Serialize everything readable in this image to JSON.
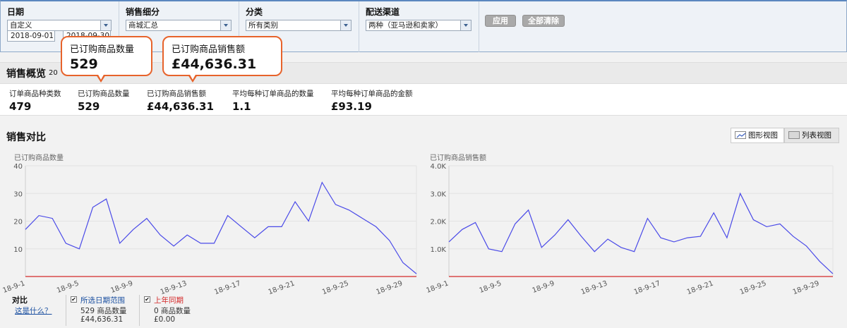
{
  "filters": {
    "date": {
      "label": "日期",
      "value": "自定义",
      "from": "2018-09-01",
      "to": "2018-09-30"
    },
    "sales_breakdown": {
      "label": "销售细分",
      "value": "商城汇总"
    },
    "category": {
      "label": "分类",
      "value": "所有类别"
    },
    "fulfillment": {
      "label": "配送渠道",
      "value": "两种（亚马逊和卖家）"
    },
    "apply_label": "应用",
    "clear_label": "全部清除"
  },
  "callouts": [
    {
      "label": "已订购商品数量",
      "value": "529"
    },
    {
      "label": "已订购商品销售额",
      "value": "£44,636.31"
    }
  ],
  "overview": {
    "title": "销售概览",
    "date_prefix": "20",
    "metrics": [
      {
        "label": "订单商品种类数",
        "value": "479"
      },
      {
        "label": "已订购商品数量",
        "value": "529"
      },
      {
        "label": "已订购商品销售额",
        "value": "£44,636.31"
      },
      {
        "label": "平均每种订单商品的数量",
        "value": "1.1"
      },
      {
        "label": "平均每种订单商品的金额",
        "value": "£93.19"
      }
    ]
  },
  "comparison": {
    "title": "销售对比",
    "graph_view_label": "图形视图",
    "table_view_label": "列表视图"
  },
  "chart_data": [
    {
      "type": "line",
      "title": "已订购商品数量",
      "x": [
        "18-9-1",
        "18-9-2",
        "18-9-3",
        "18-9-4",
        "18-9-5",
        "18-9-6",
        "18-9-7",
        "18-9-8",
        "18-9-9",
        "18-9-10",
        "18-9-11",
        "18-9-12",
        "18-9-13",
        "18-9-14",
        "18-9-15",
        "18-9-16",
        "18-9-17",
        "18-9-18",
        "18-9-19",
        "18-9-20",
        "18-9-21",
        "18-9-22",
        "18-9-23",
        "18-9-24",
        "18-9-25",
        "18-9-26",
        "18-9-27",
        "18-9-28",
        "18-9-29",
        "18-9-30"
      ],
      "x_tick_labels": [
        "18-9-1",
        "18-9-5",
        "18-9-9",
        "18-9-13",
        "18-9-17",
        "18-9-21",
        "18-9-25",
        "18-9-29"
      ],
      "y_ticks": [
        "10",
        "20",
        "30",
        "40"
      ],
      "ylim": [
        0,
        40
      ],
      "series": [
        {
          "name": "所选日期范围",
          "color": "#4a4ae8",
          "values": [
            17,
            22,
            21,
            12,
            10,
            25,
            28,
            12,
            17,
            21,
            15,
            11,
            15,
            12,
            12,
            22,
            18,
            14,
            18,
            18,
            27,
            20,
            34,
            26,
            24,
            21,
            18,
            13,
            5,
            1
          ]
        },
        {
          "name": "上年同期",
          "color": "#d42a2a",
          "values": [
            0,
            0,
            0,
            0,
            0,
            0,
            0,
            0,
            0,
            0,
            0,
            0,
            0,
            0,
            0,
            0,
            0,
            0,
            0,
            0,
            0,
            0,
            0,
            0,
            0,
            0,
            0,
            0,
            0,
            0
          ]
        }
      ]
    },
    {
      "type": "line",
      "title": "已订购商品销售额",
      "x": [
        "18-9-1",
        "18-9-2",
        "18-9-3",
        "18-9-4",
        "18-9-5",
        "18-9-6",
        "18-9-7",
        "18-9-8",
        "18-9-9",
        "18-9-10",
        "18-9-11",
        "18-9-12",
        "18-9-13",
        "18-9-14",
        "18-9-15",
        "18-9-16",
        "18-9-17",
        "18-9-18",
        "18-9-19",
        "18-9-20",
        "18-9-21",
        "18-9-22",
        "18-9-23",
        "18-9-24",
        "18-9-25",
        "18-9-26",
        "18-9-27",
        "18-9-28",
        "18-9-29",
        "18-9-30"
      ],
      "x_tick_labels": [
        "18-9-1",
        "18-9-5",
        "18-9-9",
        "18-9-13",
        "18-9-17",
        "18-9-21",
        "18-9-25",
        "18-9-29"
      ],
      "y_ticks": [
        "1.0K",
        "2.0K",
        "3.0K",
        "4.0K"
      ],
      "ylim": [
        0,
        4000
      ],
      "series": [
        {
          "name": "所选日期范围",
          "color": "#4a4ae8",
          "values": [
            1250,
            1700,
            1950,
            1000,
            900,
            1900,
            2400,
            1050,
            1500,
            2050,
            1450,
            900,
            1350,
            1050,
            900,
            2100,
            1400,
            1250,
            1400,
            1450,
            2300,
            1400,
            3000,
            2050,
            1800,
            1900,
            1450,
            1100,
            550,
            100
          ]
        },
        {
          "name": "上年同期",
          "color": "#d42a2a",
          "values": [
            0,
            0,
            0,
            0,
            0,
            0,
            0,
            0,
            0,
            0,
            0,
            0,
            0,
            0,
            0,
            0,
            0,
            0,
            0,
            0,
            0,
            0,
            0,
            0,
            0,
            0,
            0,
            0,
            0,
            0
          ]
        }
      ]
    }
  ],
  "legend": {
    "title": "对比",
    "help_link": "这是什么？",
    "items": [
      {
        "name": "所选日期范围",
        "color": "#1a4fa0",
        "checked": "✔",
        "units": "529 商品数量",
        "sales": "£44,636.31"
      },
      {
        "name": "上年同期",
        "color": "#d42a2a",
        "checked": "✔",
        "units": "0 商品数量",
        "sales": "£0.00"
      }
    ]
  }
}
